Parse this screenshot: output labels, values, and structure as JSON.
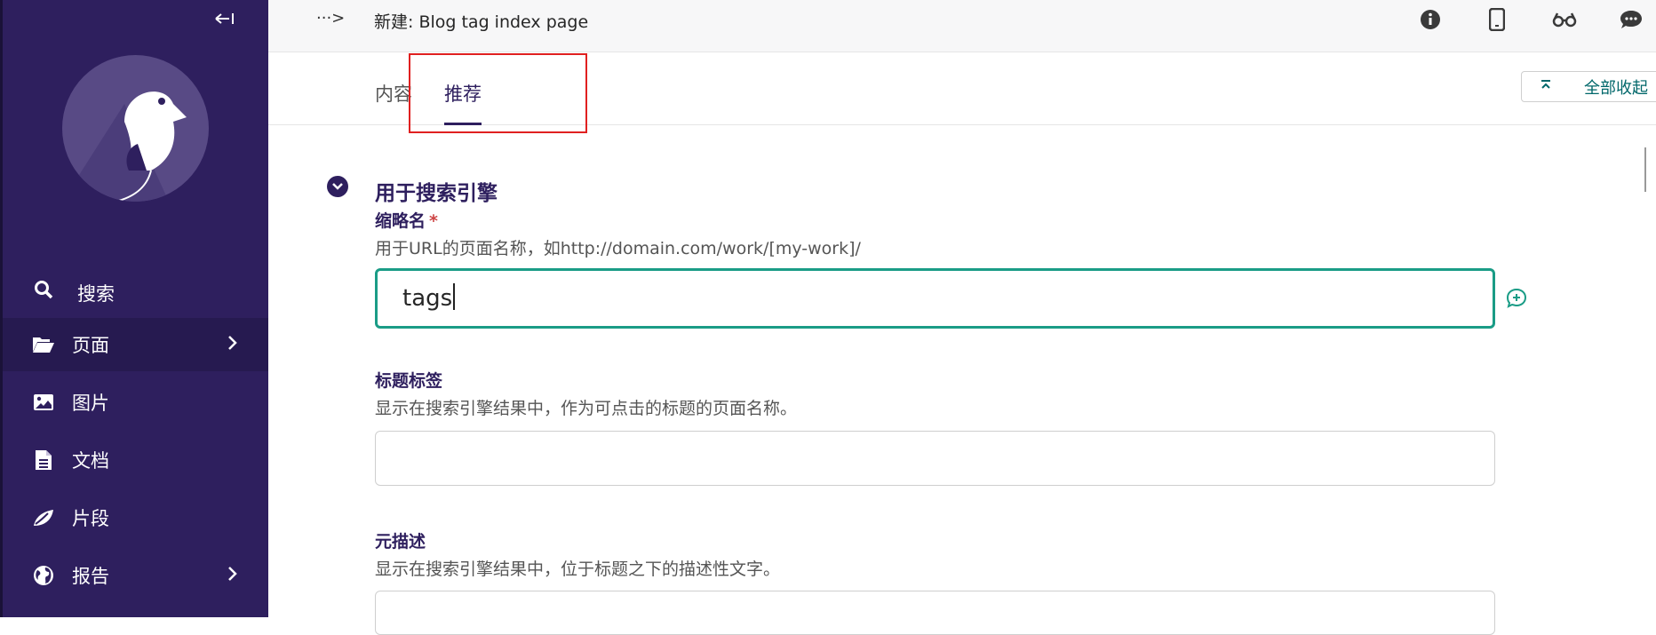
{
  "sidebar": {
    "items": [
      {
        "label": "搜索",
        "icon": "search-icon",
        "active": false,
        "has_submenu": false
      },
      {
        "label": "页面",
        "icon": "folder-open-icon",
        "active": true,
        "has_submenu": true
      },
      {
        "label": "图片",
        "icon": "image-icon",
        "active": false,
        "has_submenu": false
      },
      {
        "label": "文档",
        "icon": "document-icon",
        "active": false,
        "has_submenu": false
      },
      {
        "label": "片段",
        "icon": "snippet-icon",
        "active": false,
        "has_submenu": false
      },
      {
        "label": "报告",
        "icon": "globe-icon",
        "active": false,
        "has_submenu": true
      }
    ],
    "bg_color": "#2e1f5e"
  },
  "header": {
    "title": "新建: Blog tag index page",
    "breadcrumb_toggle": "···>",
    "icons": [
      "info-icon",
      "mobile-preview-icon",
      "glasses-icon",
      "comments-icon"
    ]
  },
  "tabs": [
    {
      "label": "内容",
      "active": false
    },
    {
      "label": "推荐",
      "active": true
    }
  ],
  "collapse_all": {
    "label": "全部收起"
  },
  "section": {
    "title": "用于搜索引擎"
  },
  "fields": {
    "slug": {
      "label": "缩略名",
      "required_mark": "*",
      "help": "用于URL的页面名称，如http://domain.com/work/[my-work]/",
      "value": "tags"
    },
    "seo_title": {
      "label": "标题标签",
      "help": "显示在搜索引擎结果中，作为可点击的标题的页面名称。",
      "value": ""
    },
    "meta_description": {
      "label": "元描述",
      "help": "显示在搜索引擎结果中，位于标题之下的描述性文字。",
      "value": ""
    }
  },
  "colors": {
    "accent": "#2e1f5e",
    "focus": "#1a9c86",
    "teal_text": "#00676a",
    "required": "#cd4444",
    "highlight_box": "#e02020"
  }
}
